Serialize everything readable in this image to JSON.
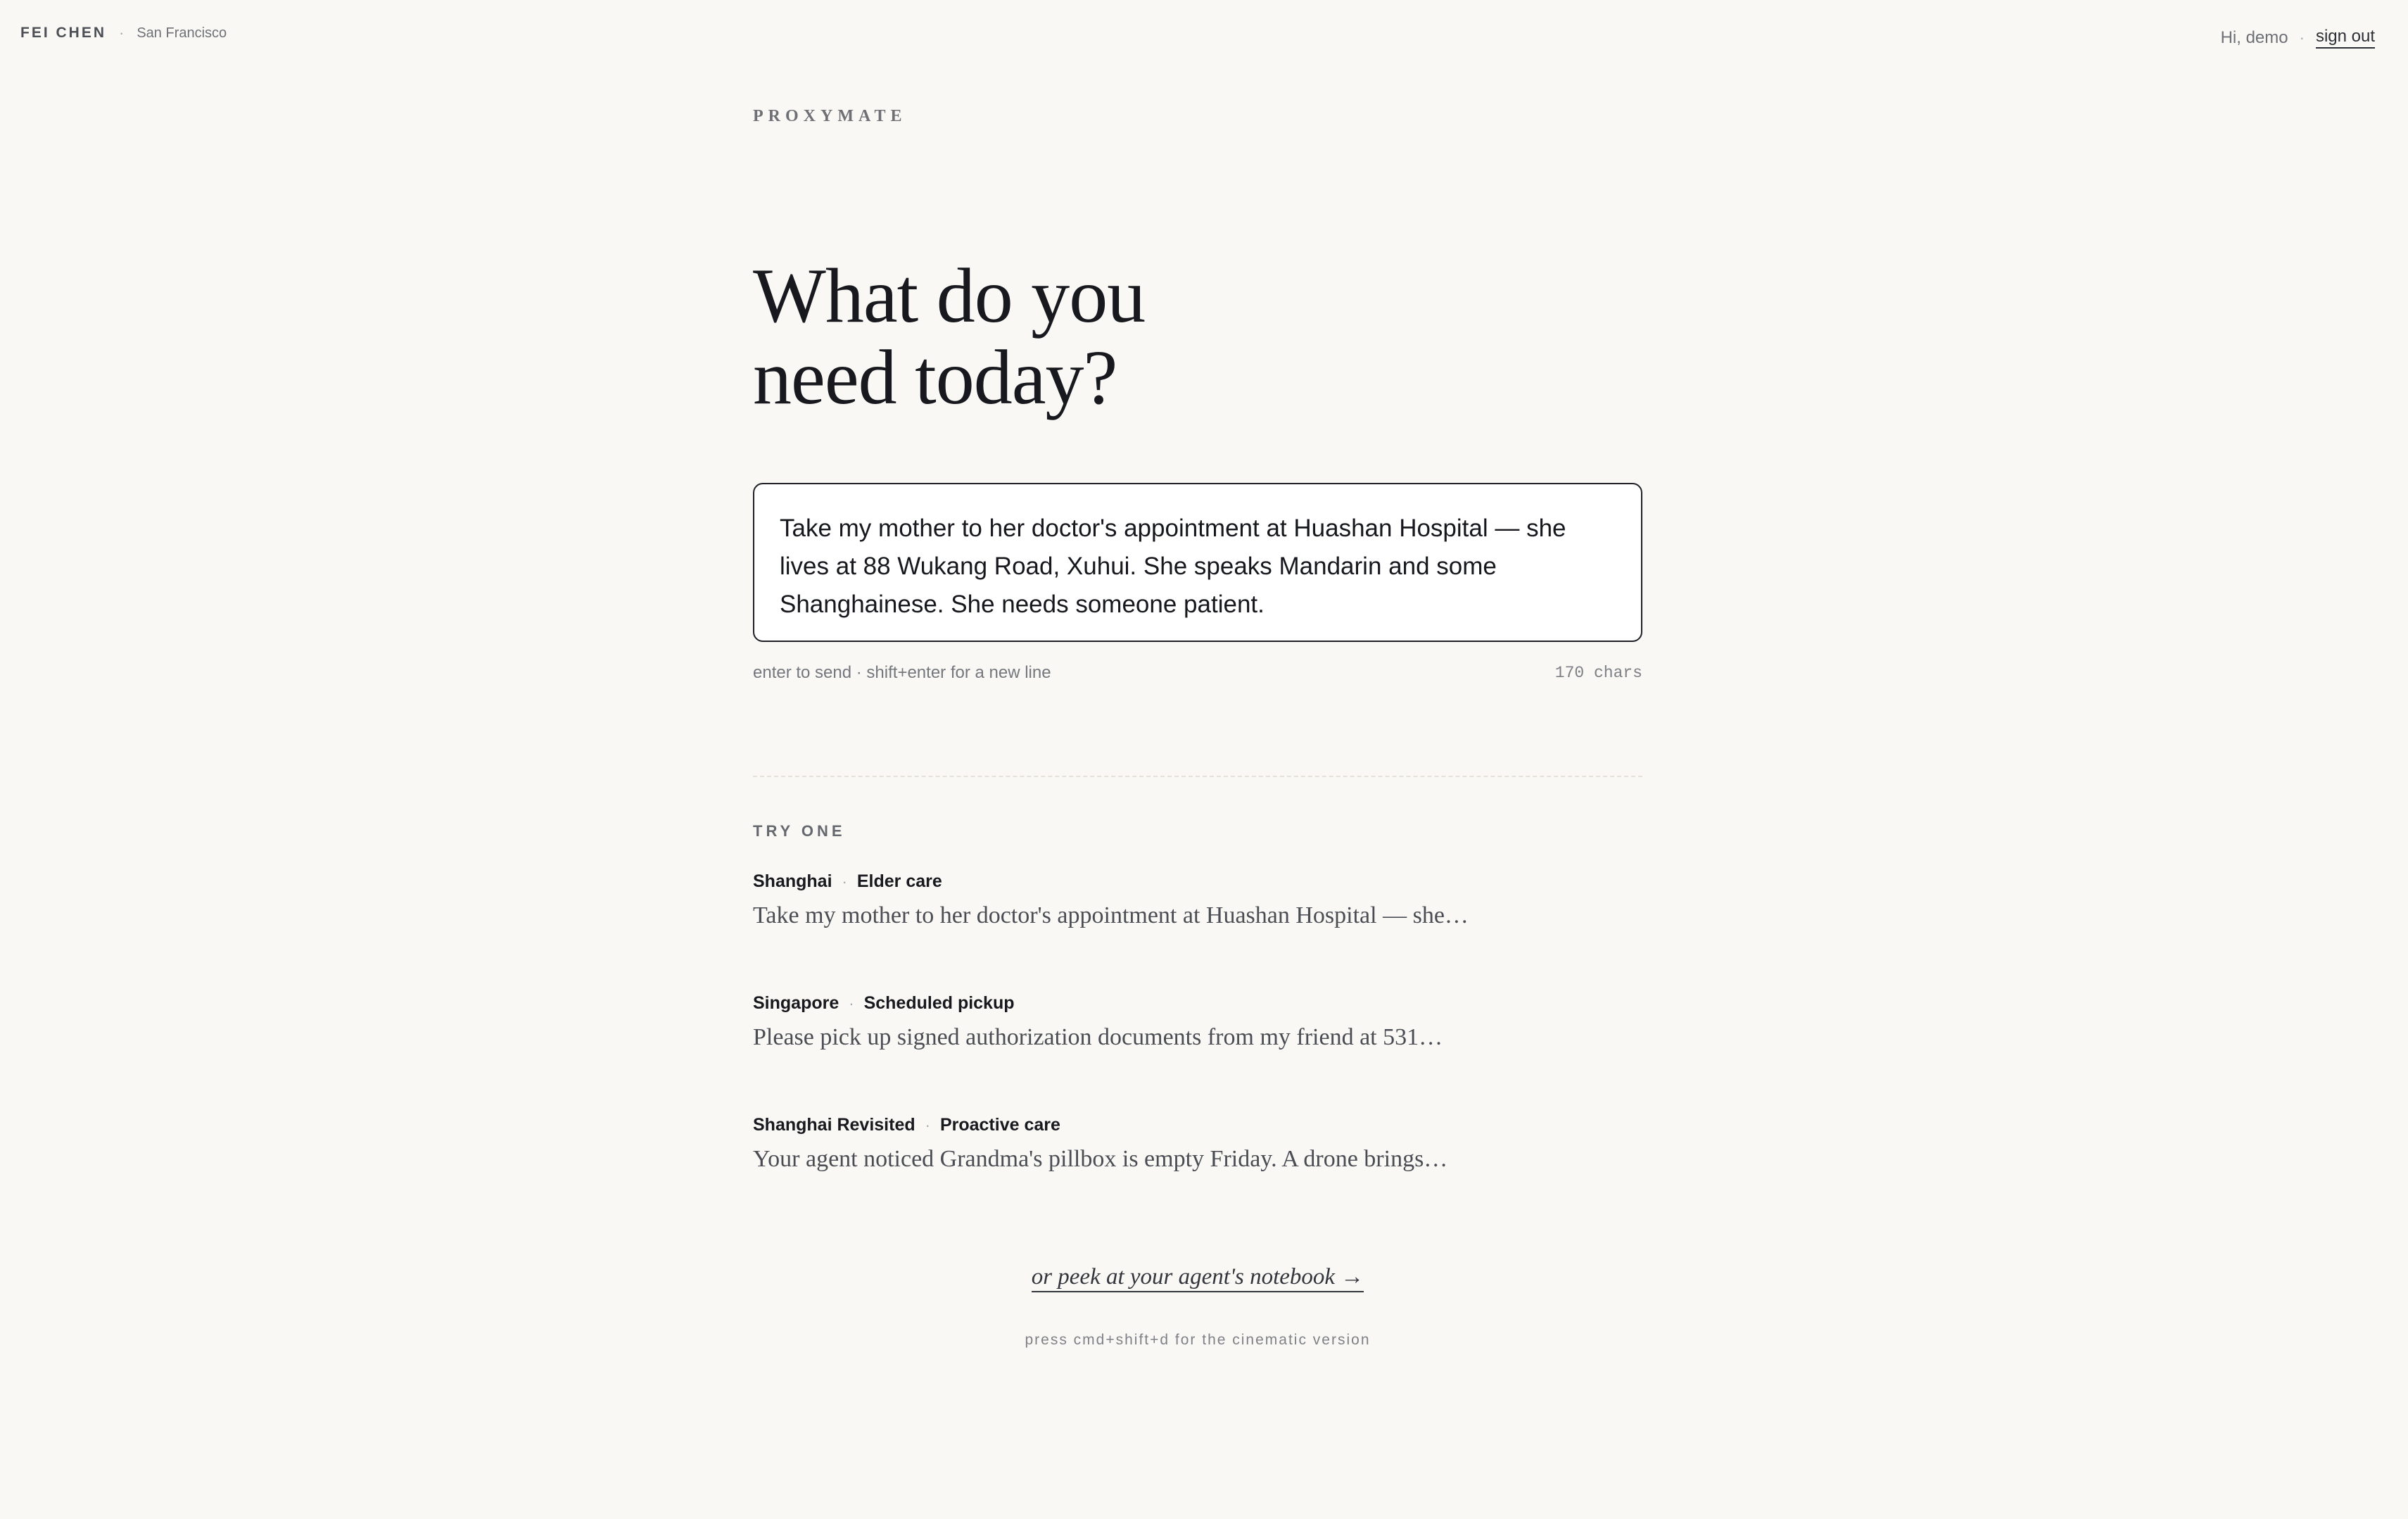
{
  "topbar": {
    "user_name": "FEI CHEN",
    "separator": "·",
    "location": "San Francisco",
    "greeting": "Hi, demo",
    "sign_out": "sign out"
  },
  "app": {
    "wordmark": "PROXYMATE"
  },
  "hero": {
    "headline_line1": "What do you",
    "headline_line2": "need today?"
  },
  "prompt": {
    "value": "Take my mother to her doctor's appointment at Huashan Hospital — she lives at 88 Wukang Road, Xuhui. She speaks Mandarin and some Shanghainese. She needs someone patient.",
    "hint": "enter to send · shift+enter for a new line",
    "char_count": "170 chars"
  },
  "try_one": {
    "label": "TRY ONE",
    "items": [
      {
        "location": "Shanghai",
        "category": "Elder care",
        "preview": "Take my mother to her doctor's appointment at Huashan Hospital — she…"
      },
      {
        "location": "Singapore",
        "category": "Scheduled pickup",
        "preview": "Please pick up signed authorization documents from my friend at 531…"
      },
      {
        "location": "Shanghai Revisited",
        "category": "Proactive care",
        "preview": "Your agent noticed Grandma's pillbox is empty Friday. A drone brings…"
      }
    ]
  },
  "footer": {
    "notebook_link": "or peek at your agent's notebook →",
    "shortcut_hint": "press cmd+shift+d for the cinematic version"
  }
}
